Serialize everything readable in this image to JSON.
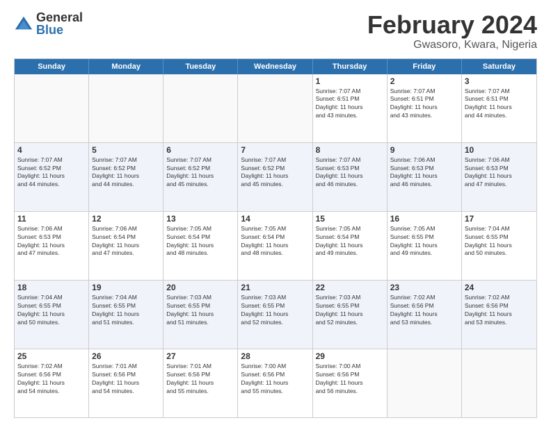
{
  "logo": {
    "general": "General",
    "blue": "Blue"
  },
  "title": "February 2024",
  "subtitle": "Gwasoro, Kwara, Nigeria",
  "headers": [
    "Sunday",
    "Monday",
    "Tuesday",
    "Wednesday",
    "Thursday",
    "Friday",
    "Saturday"
  ],
  "weeks": [
    [
      {
        "day": "",
        "info": ""
      },
      {
        "day": "",
        "info": ""
      },
      {
        "day": "",
        "info": ""
      },
      {
        "day": "",
        "info": ""
      },
      {
        "day": "1",
        "info": "Sunrise: 7:07 AM\nSunset: 6:51 PM\nDaylight: 11 hours\nand 43 minutes."
      },
      {
        "day": "2",
        "info": "Sunrise: 7:07 AM\nSunset: 6:51 PM\nDaylight: 11 hours\nand 43 minutes."
      },
      {
        "day": "3",
        "info": "Sunrise: 7:07 AM\nSunset: 6:51 PM\nDaylight: 11 hours\nand 44 minutes."
      }
    ],
    [
      {
        "day": "4",
        "info": "Sunrise: 7:07 AM\nSunset: 6:52 PM\nDaylight: 11 hours\nand 44 minutes."
      },
      {
        "day": "5",
        "info": "Sunrise: 7:07 AM\nSunset: 6:52 PM\nDaylight: 11 hours\nand 44 minutes."
      },
      {
        "day": "6",
        "info": "Sunrise: 7:07 AM\nSunset: 6:52 PM\nDaylight: 11 hours\nand 45 minutes."
      },
      {
        "day": "7",
        "info": "Sunrise: 7:07 AM\nSunset: 6:52 PM\nDaylight: 11 hours\nand 45 minutes."
      },
      {
        "day": "8",
        "info": "Sunrise: 7:07 AM\nSunset: 6:53 PM\nDaylight: 11 hours\nand 46 minutes."
      },
      {
        "day": "9",
        "info": "Sunrise: 7:06 AM\nSunset: 6:53 PM\nDaylight: 11 hours\nand 46 minutes."
      },
      {
        "day": "10",
        "info": "Sunrise: 7:06 AM\nSunset: 6:53 PM\nDaylight: 11 hours\nand 47 minutes."
      }
    ],
    [
      {
        "day": "11",
        "info": "Sunrise: 7:06 AM\nSunset: 6:53 PM\nDaylight: 11 hours\nand 47 minutes."
      },
      {
        "day": "12",
        "info": "Sunrise: 7:06 AM\nSunset: 6:54 PM\nDaylight: 11 hours\nand 47 minutes."
      },
      {
        "day": "13",
        "info": "Sunrise: 7:05 AM\nSunset: 6:54 PM\nDaylight: 11 hours\nand 48 minutes."
      },
      {
        "day": "14",
        "info": "Sunrise: 7:05 AM\nSunset: 6:54 PM\nDaylight: 11 hours\nand 48 minutes."
      },
      {
        "day": "15",
        "info": "Sunrise: 7:05 AM\nSunset: 6:54 PM\nDaylight: 11 hours\nand 49 minutes."
      },
      {
        "day": "16",
        "info": "Sunrise: 7:05 AM\nSunset: 6:55 PM\nDaylight: 11 hours\nand 49 minutes."
      },
      {
        "day": "17",
        "info": "Sunrise: 7:04 AM\nSunset: 6:55 PM\nDaylight: 11 hours\nand 50 minutes."
      }
    ],
    [
      {
        "day": "18",
        "info": "Sunrise: 7:04 AM\nSunset: 6:55 PM\nDaylight: 11 hours\nand 50 minutes."
      },
      {
        "day": "19",
        "info": "Sunrise: 7:04 AM\nSunset: 6:55 PM\nDaylight: 11 hours\nand 51 minutes."
      },
      {
        "day": "20",
        "info": "Sunrise: 7:03 AM\nSunset: 6:55 PM\nDaylight: 11 hours\nand 51 minutes."
      },
      {
        "day": "21",
        "info": "Sunrise: 7:03 AM\nSunset: 6:55 PM\nDaylight: 11 hours\nand 52 minutes."
      },
      {
        "day": "22",
        "info": "Sunrise: 7:03 AM\nSunset: 6:55 PM\nDaylight: 11 hours\nand 52 minutes."
      },
      {
        "day": "23",
        "info": "Sunrise: 7:02 AM\nSunset: 6:56 PM\nDaylight: 11 hours\nand 53 minutes."
      },
      {
        "day": "24",
        "info": "Sunrise: 7:02 AM\nSunset: 6:56 PM\nDaylight: 11 hours\nand 53 minutes."
      }
    ],
    [
      {
        "day": "25",
        "info": "Sunrise: 7:02 AM\nSunset: 6:56 PM\nDaylight: 11 hours\nand 54 minutes."
      },
      {
        "day": "26",
        "info": "Sunrise: 7:01 AM\nSunset: 6:56 PM\nDaylight: 11 hours\nand 54 minutes."
      },
      {
        "day": "27",
        "info": "Sunrise: 7:01 AM\nSunset: 6:56 PM\nDaylight: 11 hours\nand 55 minutes."
      },
      {
        "day": "28",
        "info": "Sunrise: 7:00 AM\nSunset: 6:56 PM\nDaylight: 11 hours\nand 55 minutes."
      },
      {
        "day": "29",
        "info": "Sunrise: 7:00 AM\nSunset: 6:56 PM\nDaylight: 11 hours\nand 56 minutes."
      },
      {
        "day": "",
        "info": ""
      },
      {
        "day": "",
        "info": ""
      }
    ]
  ]
}
